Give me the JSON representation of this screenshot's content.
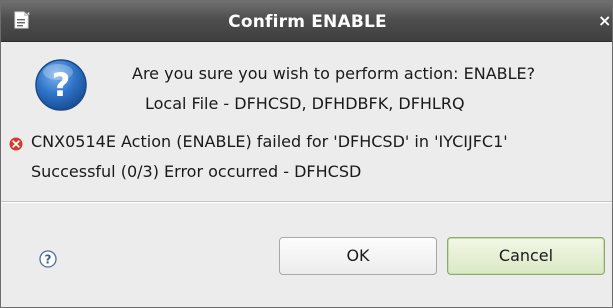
{
  "window": {
    "title": "Confirm ENABLE",
    "close_glyph": "×",
    "app_icon": "document-icon"
  },
  "message": {
    "icon": "question-icon",
    "line1": "Are you sure you wish to perform action: ENABLE?",
    "line2": "Local File - DFHCSD, DFHDBFK, DFHLRQ"
  },
  "error": {
    "icon": "error-icon",
    "line1": "CNX0514E Action (ENABLE) failed for 'DFHCSD' in 'IYCIJFC1'",
    "line2": "Successful (0/3) Error occurred - DFHCSD"
  },
  "buttons": {
    "help_icon": "help-icon",
    "ok_label": "OK",
    "cancel_label": "Cancel"
  },
  "colors": {
    "titlebar": "#4e4e4e",
    "question_icon": "#2a6fc4",
    "error_icon": "#d63b2f",
    "cancel_highlight": "#dbe8c5"
  }
}
